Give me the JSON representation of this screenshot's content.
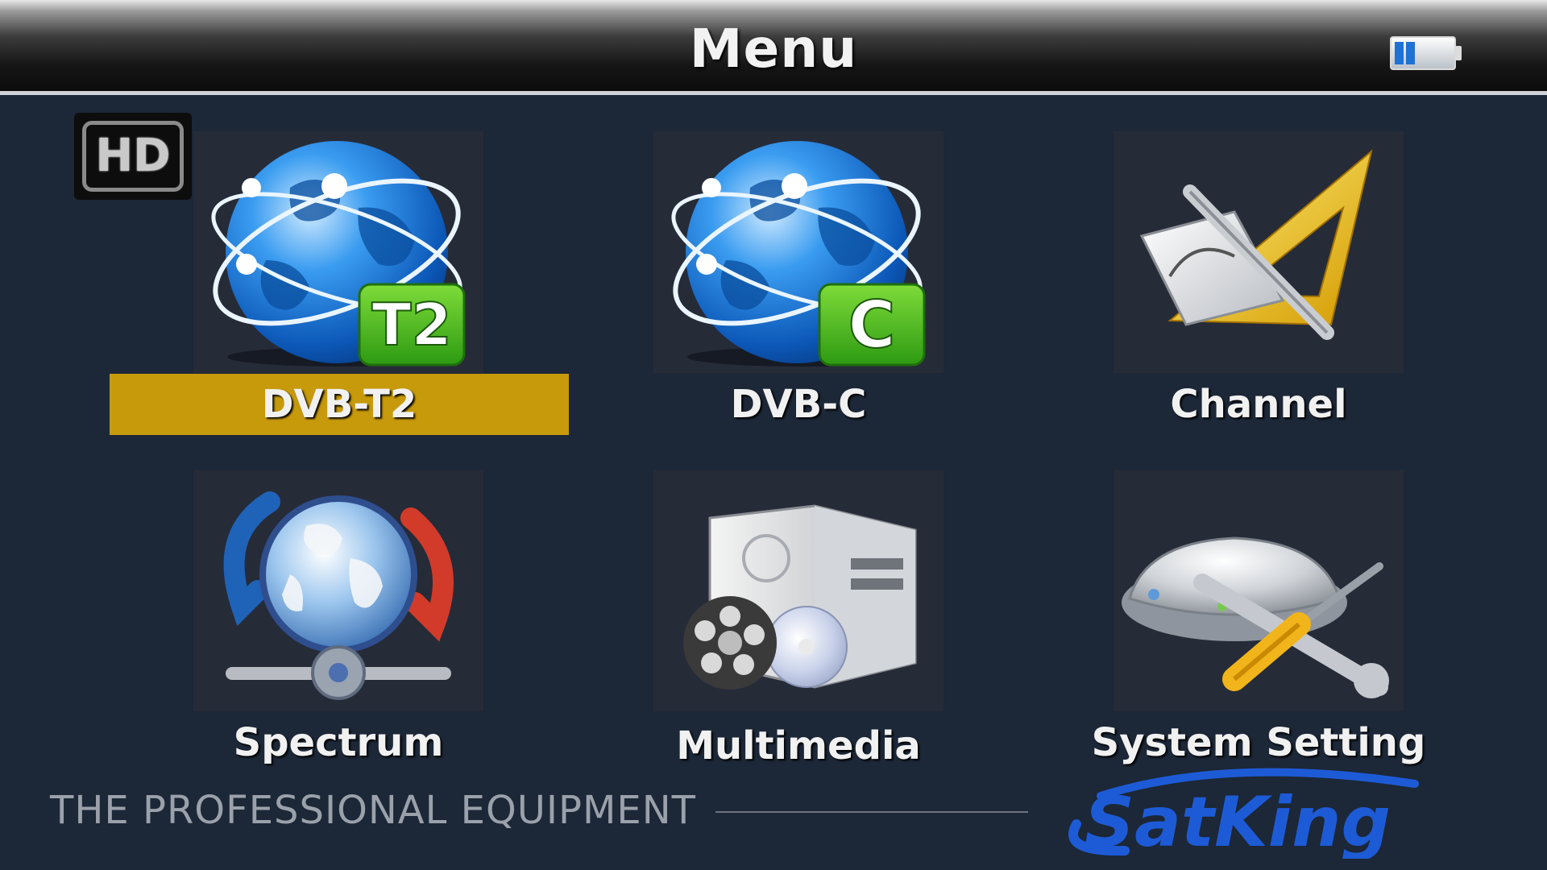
{
  "header": {
    "title": "Menu",
    "battery_icon": "battery-icon"
  },
  "badge": {
    "text": "HD"
  },
  "menu": {
    "selected_index": 0,
    "accent_color": "#c79a0c",
    "items": [
      {
        "label": "DVB-T2",
        "icon": "globe-t2-icon",
        "icon_badge": "T2"
      },
      {
        "label": "DVB-C",
        "icon": "globe-c-icon",
        "icon_badge": "C"
      },
      {
        "label": "Channel",
        "icon": "channel-edit-icon"
      },
      {
        "label": "Spectrum",
        "icon": "spectrum-globe-icon"
      },
      {
        "label": "Multimedia",
        "icon": "multimedia-icon"
      },
      {
        "label": "System Setting",
        "icon": "system-setting-icon"
      }
    ]
  },
  "footer": {
    "tagline": "THE PROFESSIONAL EQUIPMENT",
    "brand": "SatKing"
  }
}
